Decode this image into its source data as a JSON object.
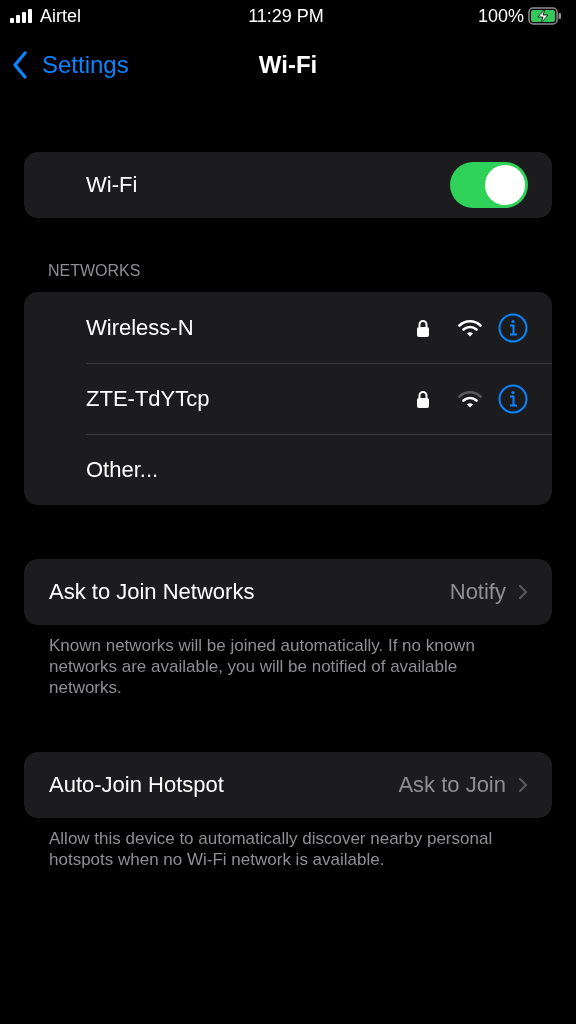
{
  "status_bar": {
    "carrier": "Airtel",
    "time": "11:29 PM",
    "battery": "100%",
    "charging": true
  },
  "nav": {
    "back": "Settings",
    "title": "Wi-Fi"
  },
  "wifi": {
    "label": "Wi-Fi",
    "on": true
  },
  "networks": {
    "header": "NETWORKS",
    "items": [
      {
        "name": "Wireless-N",
        "locked": true,
        "kind": "strong"
      },
      {
        "name": "ZTE-TdYTcp",
        "locked": true,
        "kind": "medium"
      },
      {
        "name": "Other...",
        "kind": "other"
      }
    ]
  },
  "settings": [
    {
      "label": "Ask to Join Networks",
      "value": "Notify",
      "footer": "Known networks will be joined automatically. If no known networks are available, you will be notified of available networks."
    },
    {
      "label": "Auto-Join Hotspot",
      "value": "Ask to Join",
      "footer": "Allow this device to automatically discover nearby personal hotspots when no Wi-Fi network is available."
    }
  ]
}
